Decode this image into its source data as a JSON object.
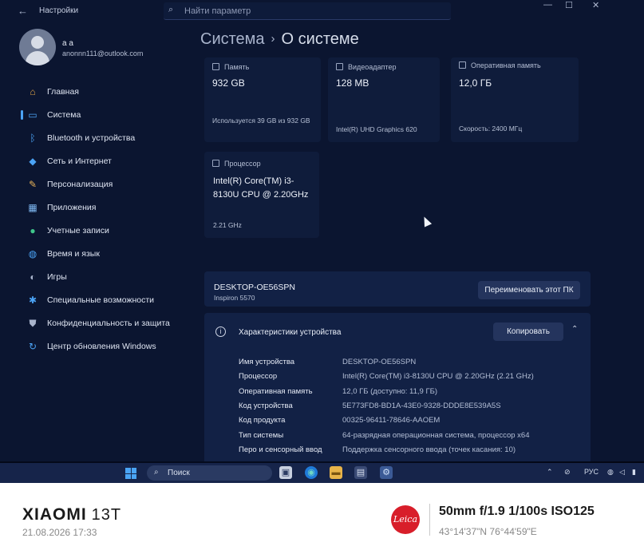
{
  "titlebar": {
    "back": "←",
    "title": "Настройки",
    "search_placeholder": "Найти параметр",
    "minimize": "—",
    "maximize": "☐",
    "close": "✕"
  },
  "user": {
    "name": "a a",
    "email": "anonnn111@outlook.com"
  },
  "sidebar": {
    "items": [
      {
        "label": "Главная",
        "icon": "home-icon",
        "glyph": "⌂",
        "color": "#e2a447"
      },
      {
        "label": "Система",
        "icon": "monitor-icon",
        "glyph": "▭",
        "color": "#4ba3f5"
      },
      {
        "label": "Bluetooth и устройства",
        "icon": "bluetooth-icon",
        "glyph": "ᛒ",
        "color": "#4ba3f5"
      },
      {
        "label": "Сеть и Интернет",
        "icon": "wifi-icon",
        "glyph": "◆",
        "color": "#4ba3f5"
      },
      {
        "label": "Персонализация",
        "icon": "brush-icon",
        "glyph": "✎",
        "color": "#e9b45a"
      },
      {
        "label": "Приложения",
        "icon": "apps-icon",
        "glyph": "▦",
        "color": "#7db6f0"
      },
      {
        "label": "Учетные записи",
        "icon": "person-icon",
        "glyph": "●",
        "color": "#3fc78b"
      },
      {
        "label": "Время и язык",
        "icon": "globe-icon",
        "glyph": "◍",
        "color": "#4ba3f5"
      },
      {
        "label": "Игры",
        "icon": "gamepad-icon",
        "glyph": "◐",
        "color": "#a9b4cc"
      },
      {
        "label": "Специальные возможности",
        "icon": "accessibility-icon",
        "glyph": "✱",
        "color": "#4ba3f5"
      },
      {
        "label": "Конфиденциальность и защита",
        "icon": "shield-icon",
        "glyph": "⛊",
        "color": "#a9b4cc"
      },
      {
        "label": "Центр обновления Windows",
        "icon": "update-icon",
        "glyph": "↻",
        "color": "#4ba3f5"
      }
    ]
  },
  "breadcrumb": {
    "parent": "Система",
    "sep": "›",
    "current": "О системе"
  },
  "cards": {
    "storage": {
      "label": "Память",
      "value": "932 GB",
      "sub": "Используется 39 GB из 932 GB"
    },
    "gpu": {
      "label": "Видеоадаптер",
      "value": "128 MB",
      "sub": "Intel(R) UHD Graphics 620"
    },
    "ram": {
      "label": "Оперативная память",
      "value": "12,0 ГБ",
      "sub": "Скорость: 2400 МГц"
    },
    "cpu": {
      "label": "Процессор",
      "value": "Intel(R) Core(TM) i3-8130U CPU @ 2.20GHz",
      "sub": "2.21 GHz"
    }
  },
  "device": {
    "name": "DESKTOP-OE56SPN",
    "model": "Inspiron 5570",
    "rename_label": "Переименовать этот ПК"
  },
  "specs": {
    "title": "Характеристики устройства",
    "copy_label": "Копировать",
    "rows": [
      {
        "k": "Имя устройства",
        "v": "DESKTOP-OE56SPN"
      },
      {
        "k": "Процессор",
        "v": "Intel(R) Core(TM) i3-8130U CPU @ 2.20GHz (2.21 GHz)"
      },
      {
        "k": "Оперативная память",
        "v": "12,0 ГБ (доступно: 11,9 ГБ)"
      },
      {
        "k": "Код устройства",
        "v": "5E773FD8-BD1A-43E0-9328-DDDE8E539A5S"
      },
      {
        "k": "Код продукта",
        "v": "00325-96411-78646-AAOEM"
      },
      {
        "k": "Тип системы",
        "v": "64-разрядная операционная система, процессор x64"
      },
      {
        "k": "Перо и сенсорный ввод",
        "v": "Поддержка сенсорного ввода (точек касания: 10)"
      }
    ]
  },
  "taskbar": {
    "search_label": "Поиск",
    "lang": "РУС"
  },
  "footer": {
    "brand": "XIAOMI",
    "model": "13T",
    "date": "21.08.2026 17:33",
    "leica": "Leica",
    "exif": "50mm  f/1.9  1/100s  ISO125",
    "gps": "43°14'37\"N  76°44'59\"E"
  }
}
